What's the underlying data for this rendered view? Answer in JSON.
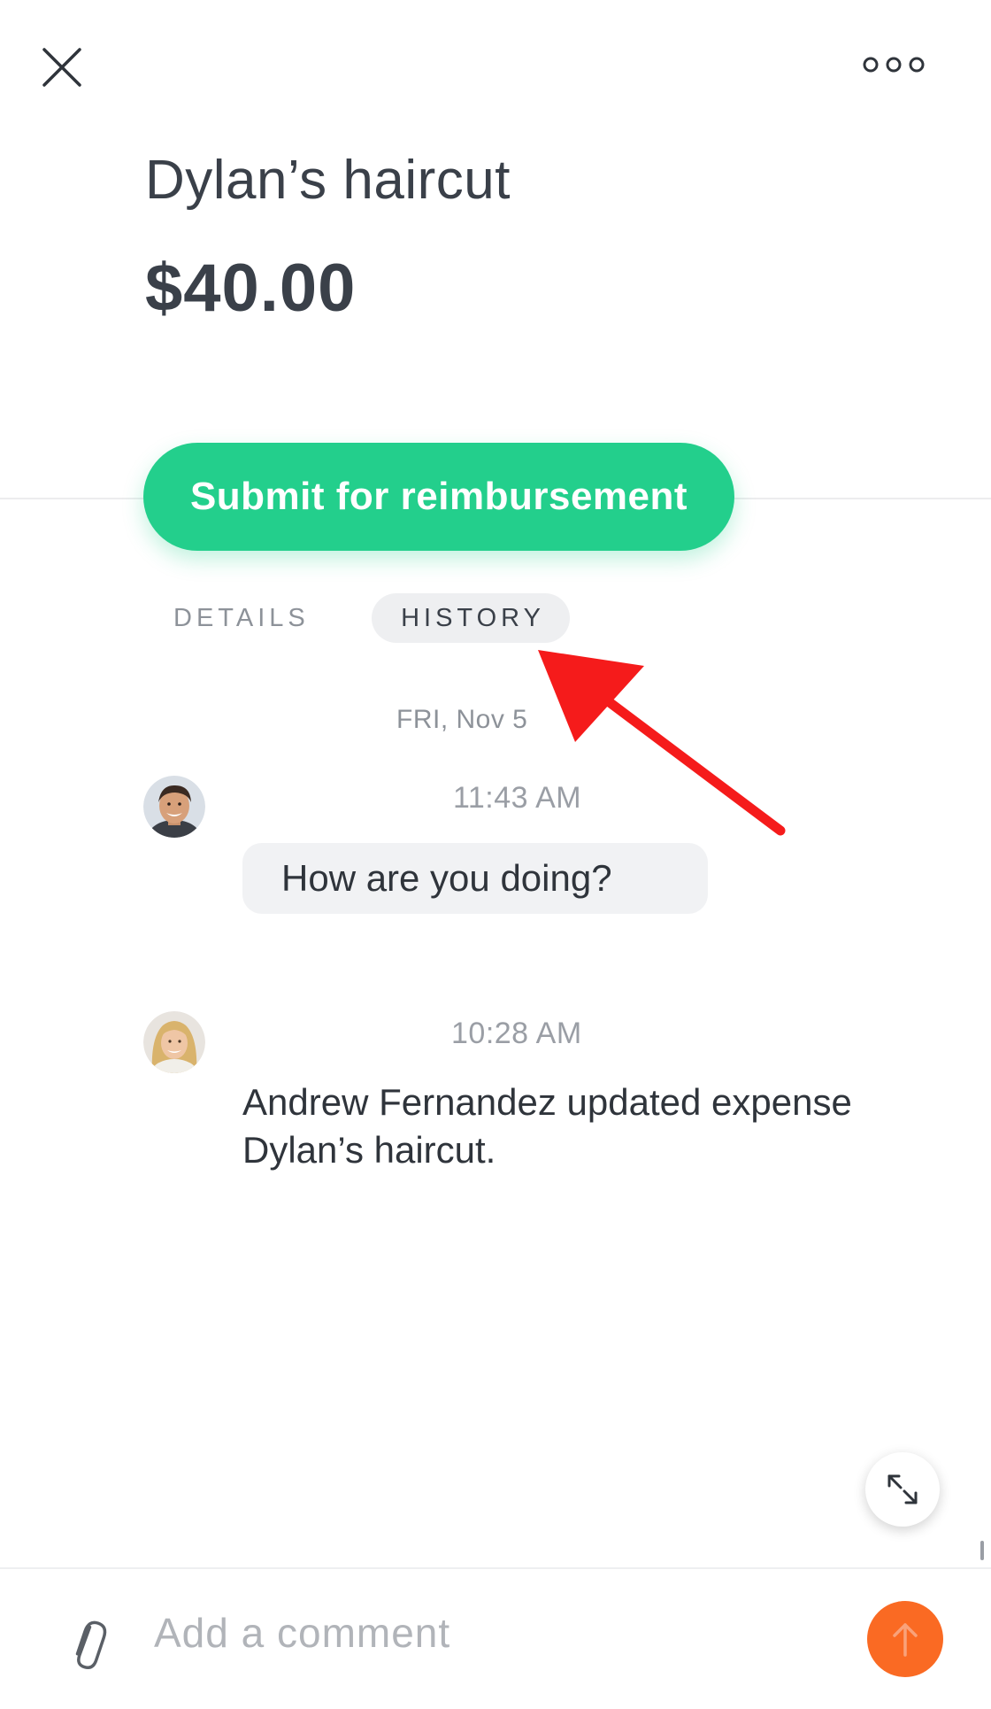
{
  "header": {
    "close_icon": "close-icon",
    "more_icon": "more-horizontal-icon"
  },
  "expense": {
    "title": "Dylan’s haircut",
    "amount": "$40.00"
  },
  "actions": {
    "submit_label": "Submit for reimbursement",
    "submit_color": "#23cf8c"
  },
  "tabs": [
    {
      "label": "DETAILS",
      "active": false
    },
    {
      "label": "HISTORY",
      "active": true
    }
  ],
  "history": {
    "date": "FRI, Nov 5",
    "entries": [
      {
        "type": "comment",
        "avatar": "male-user-avatar",
        "time": "11:43 AM",
        "text": "How are you doing?"
      },
      {
        "type": "event",
        "avatar": "female-user-avatar",
        "time": "10:28 AM",
        "text": "Andrew Fernandez updated expense Dylan’s haircut."
      }
    ]
  },
  "annotation": {
    "arrow_color": "#f51b1b",
    "target": "HISTORY"
  },
  "expand_icon": "expand-icon",
  "composer": {
    "placeholder": "Add a comment",
    "attach_icon": "paperclip-icon",
    "send_icon": "arrow-up-icon",
    "send_color": "#fa6a23"
  }
}
